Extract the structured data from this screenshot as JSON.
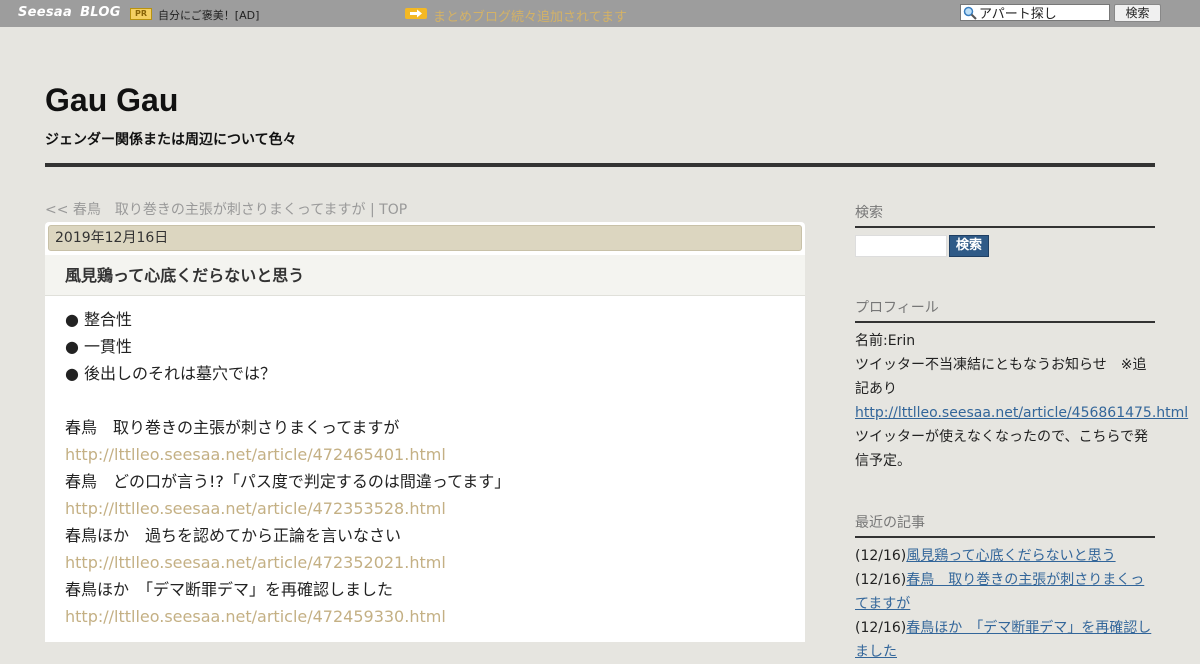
{
  "topbar": {
    "logo_seesaa": "Seesaa",
    "logo_blog": "BLOG",
    "pr_badge": "PR",
    "pr_text": "自分にご褒美！[AD]",
    "notice_icon": "arrow-right-icon",
    "notice_text": "まとめブログ続々追加されてます",
    "search_value": "アパート探し",
    "search_button": "検索"
  },
  "header": {
    "title": "Gau Gau",
    "description": "ジェンダー関係または周辺について色々"
  },
  "nav": {
    "prev": "<< 春鳥　取り巻きの主張が刺さりまくってますが",
    "separator": " | ",
    "top": "TOP"
  },
  "post": {
    "date": "2019年12月16日",
    "title": "風見鶏って心底くだらないと思う",
    "lines": [
      {
        "text": "● 整合性",
        "link": false
      },
      {
        "text": "● 一貫性",
        "link": false
      },
      {
        "text": "● 後出しのそれは墓穴では？",
        "link": false
      },
      {
        "text": "",
        "link": false
      },
      {
        "text": "春鳥　取り巻きの主張が刺さりまくってますが",
        "link": false
      },
      {
        "text": "http://lttlleo.seesaa.net/article/472465401.html",
        "link": true
      },
      {
        "text": "春鳥　どの口が言う!?「パス度で判定するのは間違ってます」",
        "link": false
      },
      {
        "text": "http://lttlleo.seesaa.net/article/472353528.html",
        "link": true
      },
      {
        "text": "春鳥ほか　過ちを認めてから正論を言いなさい",
        "link": false
      },
      {
        "text": "http://lttlleo.seesaa.net/article/472352021.html",
        "link": true
      },
      {
        "text": "春鳥ほか　「デマ断罪デマ」を再確認しました",
        "link": false
      },
      {
        "text": "http://lttlleo.seesaa.net/article/472459330.html",
        "link": true
      }
    ]
  },
  "sidebar": {
    "search": {
      "heading": "検索",
      "button": "検索"
    },
    "profile": {
      "heading": "プロフィール",
      "name": "名前:Erin",
      "notice": "ツイッター不当凍結にともなうお知らせ　※追記あり",
      "link": "http://lttlleo.seesaa.net/article/456861475.html",
      "text": "ツイッターが使えなくなったので、こちらで発信予定。"
    },
    "recent": {
      "heading": "最近の記事",
      "items": [
        {
          "date": "(12/16)",
          "title": "風見鶏って心底くだらないと思う"
        },
        {
          "date": "(12/16)",
          "title": "春鳥　取り巻きの主張が刺さりまくってますが"
        },
        {
          "date": "(12/16)",
          "title": "春鳥ほか　「デマ断罪デマ」を再確認しました"
        }
      ]
    }
  },
  "colors": {
    "page_bg": "#e6e5e0",
    "topbar_bg": "#9d9d9d",
    "date_bar_bg": "#dcd6c0",
    "link_muted": "#c4b084",
    "link_blue": "#33669a",
    "search_btn": "#2f5a87"
  }
}
